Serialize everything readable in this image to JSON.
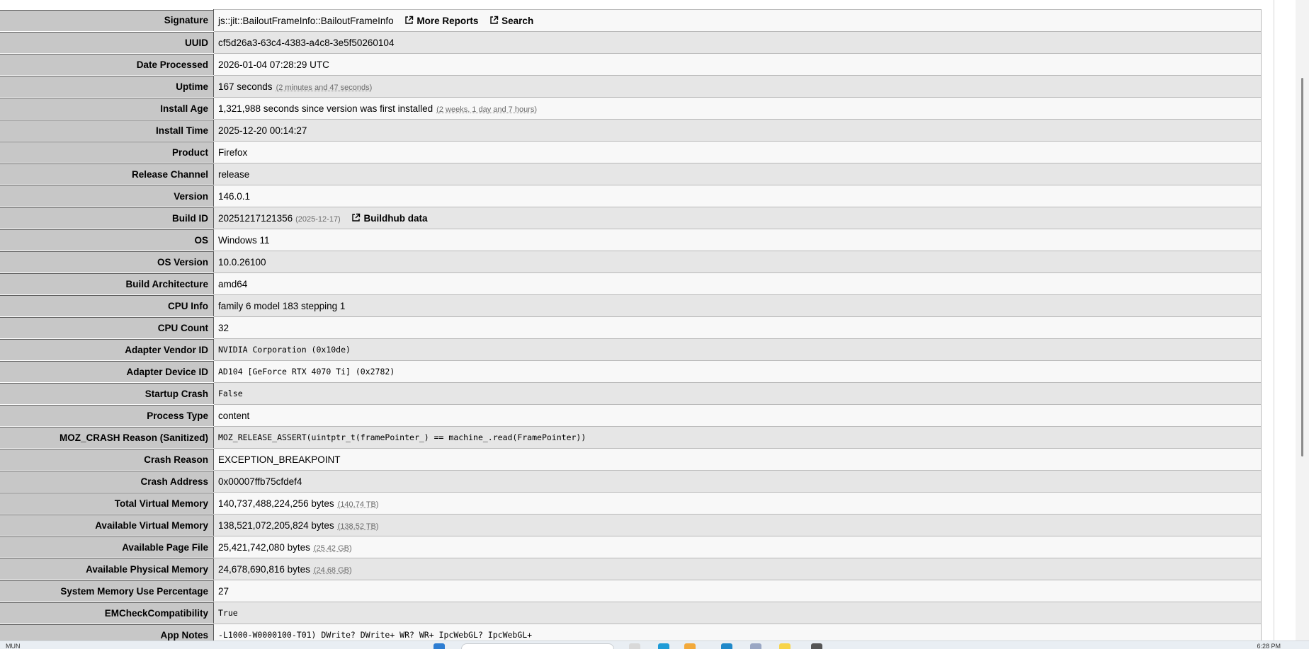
{
  "rows": [
    {
      "label": "Signature",
      "value": "js::jit::BailoutFrameInfo::BailoutFrameInfo",
      "links": [
        "More Reports",
        "Search"
      ]
    },
    {
      "label": "UUID",
      "value": "cf5d26a3-63c4-4383-a4c8-3e5f50260104"
    },
    {
      "label": "Date Processed",
      "value": "2026-01-04 07:28:29 UTC"
    },
    {
      "label": "Uptime",
      "value": "167 seconds",
      "human": "(2 minutes and 47 seconds)"
    },
    {
      "label": "Install Age",
      "value": "1,321,988 seconds since version was first installed",
      "human": "(2 weeks, 1 day and 7 hours)"
    },
    {
      "label": "Install Time",
      "value": "2025-12-20 00:14:27"
    },
    {
      "label": "Product",
      "value": "Firefox"
    },
    {
      "label": "Release Channel",
      "value": "release"
    },
    {
      "label": "Version",
      "value": "146.0.1"
    },
    {
      "label": "Build ID",
      "value": "20251217121356",
      "dim": "(2025-12-17)",
      "link": "Buildhub data"
    },
    {
      "label": "OS",
      "value": "Windows 11"
    },
    {
      "label": "OS Version",
      "value": "10.0.26100"
    },
    {
      "label": "Build Architecture",
      "value": "amd64"
    },
    {
      "label": "CPU Info",
      "value": "family 6 model 183 stepping 1"
    },
    {
      "label": "CPU Count",
      "value": "32"
    },
    {
      "label": "Adapter Vendor ID",
      "value": "NVIDIA Corporation (0x10de)"
    },
    {
      "label": "Adapter Device ID",
      "value": "AD104 [GeForce RTX 4070 Ti] (0x2782)"
    },
    {
      "label": "Startup Crash",
      "value": "False"
    },
    {
      "label": "Process Type",
      "value": "content"
    },
    {
      "label": "MOZ_CRASH Reason (Sanitized)",
      "value": "MOZ_RELEASE_ASSERT(uintptr_t(framePointer_) == machine_.read(FramePointer))"
    },
    {
      "label": "Crash Reason",
      "value": "EXCEPTION_BREAKPOINT"
    },
    {
      "label": "Crash Address",
      "value": "0x00007ffb75cfdef4"
    },
    {
      "label": "Total Virtual Memory",
      "value": "140,737,488,224,256 bytes",
      "human": "(140.74 TB)"
    },
    {
      "label": "Available Virtual Memory",
      "value": "138,521,072,205,824 bytes",
      "human": "(138.52 TB)"
    },
    {
      "label": "Available Page File",
      "value": "25,421,742,080 bytes",
      "human": "(25.42 GB)"
    },
    {
      "label": "Available Physical Memory",
      "value": "24,678,690,816 bytes",
      "human": "(24.68 GB)"
    },
    {
      "label": "System Memory Use Percentage",
      "value": "27"
    },
    {
      "label": "EMCheckCompatibility",
      "value": "True"
    },
    {
      "label": "App Notes",
      "value": "-L1000-W0000100-T01) DWrite? DWrite+ WR? WR+ IpcWebGL? IpcWebGL+"
    }
  ],
  "taskbar": {
    "language": "MUN",
    "clock": "6:28 PM"
  }
}
